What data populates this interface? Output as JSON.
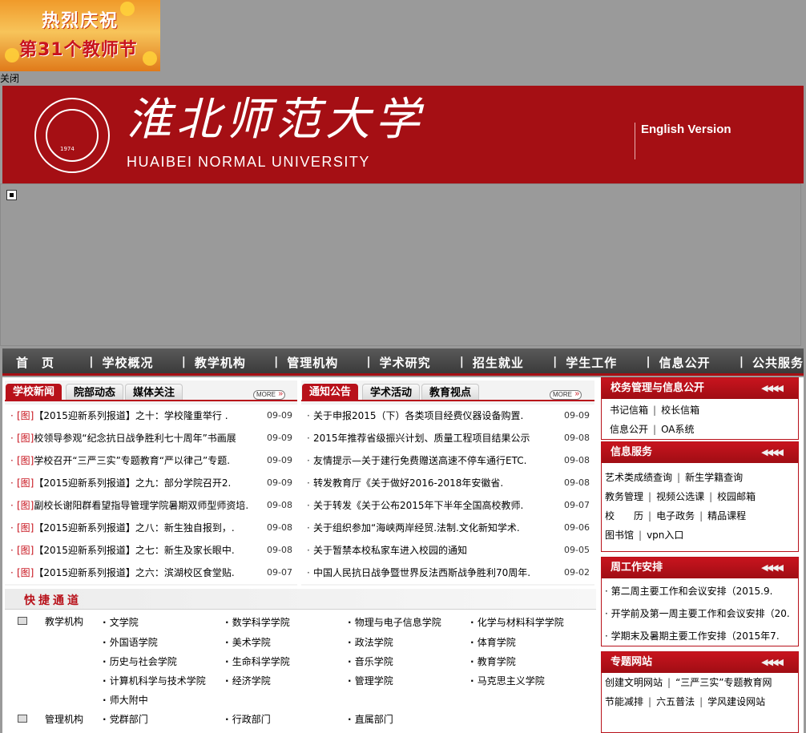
{
  "ad": {
    "line1": "热烈庆祝",
    "line2": "第31个教师节"
  },
  "close_label": "关闭",
  "header": {
    "seal_year": "1974",
    "name_cn": "淮北师范大学",
    "name_en": "HUAIBEI NORMAL UNIVERSITY",
    "english_link": "English Version"
  },
  "nav": [
    "首　页",
    "学校概况",
    "教学机构",
    "管理机构",
    "学术研究",
    "招生就业",
    "学生工作",
    "信息公开",
    "公共服务"
  ],
  "news_panel": {
    "tabs": [
      "学校新闻",
      "院部动态",
      "媒体关注"
    ],
    "more": "MORE",
    "items": [
      {
        "tag": "[图]",
        "title": "【2015迎新系列报道】之十：学校隆重举行 .",
        "date": "09-09"
      },
      {
        "tag": "[图]",
        "title": "校领导参观“纪念抗日战争胜利七十周年”书画展",
        "date": "09-09"
      },
      {
        "tag": "[图]",
        "title": "学校召开“三严三实”专题教育“严以律己”专题.",
        "date": "09-09"
      },
      {
        "tag": "[图]",
        "title": "【2015迎新系列报道】之九：部分学院召开2.",
        "date": "09-09"
      },
      {
        "tag": "[图]",
        "title": "副校长谢阳群看望指导管理学院暑期双师型师资培.",
        "date": "09-08"
      },
      {
        "tag": "[图]",
        "title": "【2015迎新系列报道】之八：新生独自报到，.",
        "date": "09-08"
      },
      {
        "tag": "[图]",
        "title": "【2015迎新系列报道】之七：新生及家长眼中.",
        "date": "09-08"
      },
      {
        "tag": "[图]",
        "title": "【2015迎新系列报道】之六：滨湖校区食堂贴.",
        "date": "09-07"
      }
    ]
  },
  "notice_panel": {
    "tabs": [
      "通知公告",
      "学术活动",
      "教育视点"
    ],
    "more": "MORE",
    "items": [
      {
        "title": "关于申报2015（下）各类项目经费仪器设备购置.",
        "date": "09-09"
      },
      {
        "title": "2015年推荐省级振兴计划、质量工程项目结果公示",
        "date": "09-08"
      },
      {
        "title": "友情提示—关于建行免费赠送高速不停车通行ETC.",
        "date": "09-08"
      },
      {
        "title": "转发教育厅《关于做好2016-2018年安徽省.",
        "date": "09-08"
      },
      {
        "title": "关于转发《关于公布2015年下半年全国高校教师.",
        "date": "09-07"
      },
      {
        "title": "关于组织参加“海峡两岸经贸.法制.文化新知学术.",
        "date": "09-06"
      },
      {
        "title": "关于暂禁本校私家车进入校园的通知",
        "date": "09-05"
      },
      {
        "title": "中国人民抗日战争暨世界反法西斯战争胜利70周年.",
        "date": "09-02"
      }
    ]
  },
  "quick": {
    "title": "快捷通道",
    "cat1": "教学机构",
    "cat2": "管理机构",
    "teaching": [
      "文学院",
      "数学科学学院",
      "物理与电子信息学院",
      "化学与材料科学学院",
      "外国语学院",
      "美术学院",
      "政法学院",
      "体育学院",
      "历史与社会学院",
      "生命科学学院",
      "音乐学院",
      "教育学院",
      "计算机科学与技术学院",
      "经济学院",
      "管理学院",
      "马克思主义学院",
      "师大附中"
    ],
    "admin": [
      "党群部门",
      "行政部门",
      "直属部门"
    ]
  },
  "side": {
    "box1": {
      "title": "校务管理与信息公开",
      "links": [
        [
          "书记信箱",
          "校长信箱"
        ],
        [
          "信息公开",
          "OA系统"
        ]
      ]
    },
    "box2": {
      "title": "信息服务",
      "links": [
        [
          "艺术类成绩查询",
          "新生学籍查询"
        ],
        [
          "教务管理",
          "视频公选课",
          "校园邮箱"
        ],
        [
          "校　　历",
          "电子政务",
          "精品课程"
        ],
        [
          "图书馆",
          "vpn入口"
        ]
      ]
    },
    "box3": {
      "title": "周工作安排",
      "items": [
        "第二周主要工作和会议安排（2015.9.",
        "开学前及第一周主要工作和会议安排（20.",
        "学期末及暑期主要工作安排（2015年7."
      ]
    },
    "box4": {
      "title": "专题网站",
      "links": [
        [
          "创建文明网站",
          "“三严三实”专题教育网"
        ],
        [
          "节能减排",
          "六五普法",
          "学风建设网站"
        ]
      ]
    }
  }
}
